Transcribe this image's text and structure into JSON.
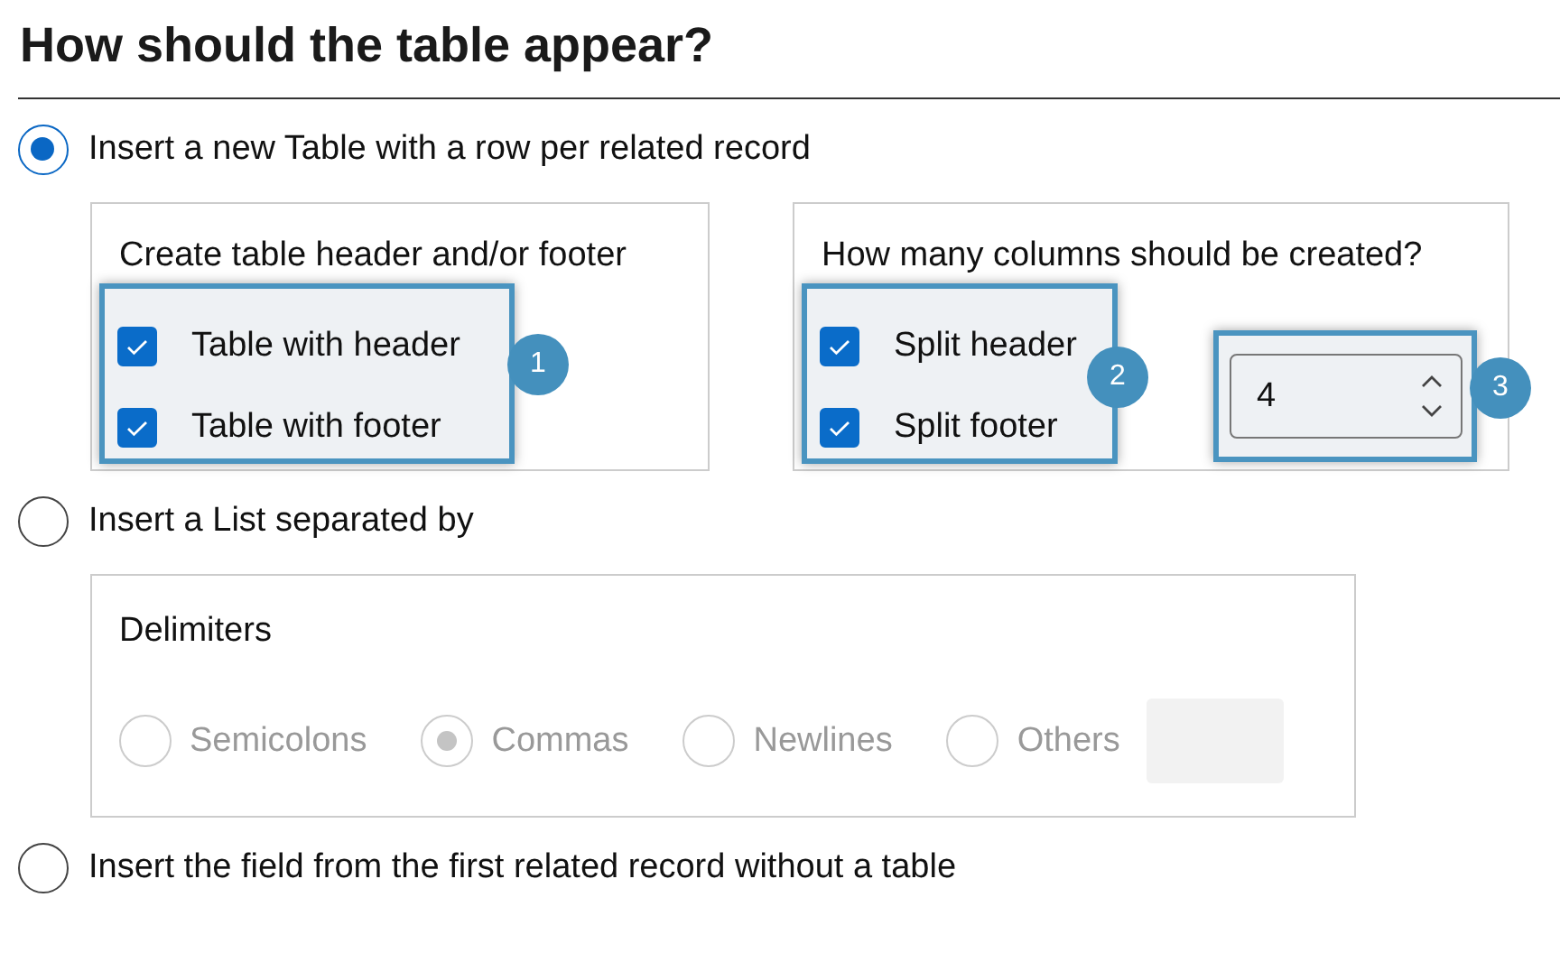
{
  "title": "How should the table appear?",
  "modes": [
    {
      "label": "Insert a new Table with a row per related record",
      "selected": true
    },
    {
      "label": "Insert a List separated by",
      "selected": false
    },
    {
      "label": "Insert the field from the first related record without a table",
      "selected": false
    }
  ],
  "header_footer": {
    "label": "Create table header and/or footer",
    "callout": "1",
    "checkboxes": [
      {
        "label": "Table with header",
        "checked": true
      },
      {
        "label": "Table with footer",
        "checked": true
      }
    ]
  },
  "columns": {
    "label": "How many columns should be created?",
    "callout": "2",
    "checkboxes": [
      {
        "label": "Split header",
        "checked": true
      },
      {
        "label": "Split footer",
        "checked": true
      }
    ],
    "spinner": {
      "value": "4",
      "callout": "3"
    }
  },
  "delimiters": {
    "label": "Delimiters",
    "disabled": true,
    "options": [
      {
        "label": "Semicolons",
        "selected": false
      },
      {
        "label": "Commas",
        "selected": true
      },
      {
        "label": "Newlines",
        "selected": false
      },
      {
        "label": "Others",
        "selected": false
      }
    ]
  }
}
